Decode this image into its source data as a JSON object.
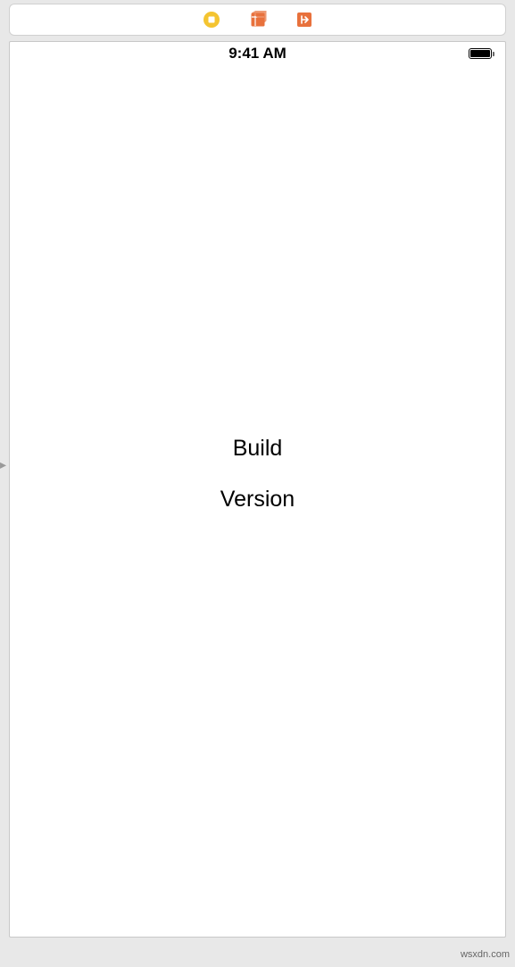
{
  "toolbar": {
    "icons": {
      "stop": "stop-icon",
      "objects": "objects-library-icon",
      "exit": "exit-icon"
    }
  },
  "statusBar": {
    "time": "9:41 AM"
  },
  "content": {
    "buildLabel": "Build",
    "versionLabel": "Version"
  },
  "watermark": "wsxdn.com"
}
